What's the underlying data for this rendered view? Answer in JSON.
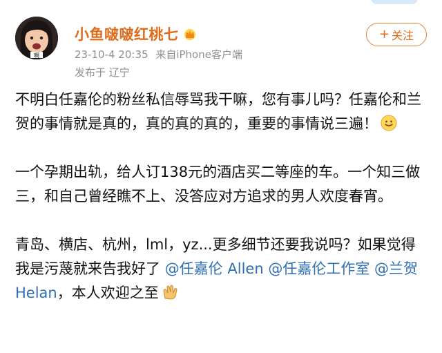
{
  "user": {
    "name": "小鱼啵啵红桃七",
    "meta_date": "23-10-4 20:35",
    "meta_source": "来自iPhone客户端",
    "location": "发布于 辽宁",
    "avatar_caption": "啊"
  },
  "follow_button": {
    "label": "关注",
    "icon": "plus-icon"
  },
  "post": {
    "p1": "不明白任嘉伦的粉丝私信辱骂我干嘛，您有事儿吗？任嘉伦和兰贺的事情就是真的，真的真的真的，重要的事情说三遍！",
    "p2": "一个孕期出轨，给人订138元的酒店买二等座的车。一个知三做三，和自己曾经瞧不上、没答应对方追求的男人欢度春宵。",
    "p3_text": "青岛、横店、杭州，lml，yz...更多细节还要我说吗？如果觉得我是污蔑就来告我好了 ",
    "mention1": "@任嘉伦 Allen",
    "mention2": "@任嘉伦工作室",
    "mention3": "@兰贺 Helan",
    "p3_tail": "，本人欢迎之至"
  },
  "colors": {
    "name": "#e06a17",
    "mention": "#2f6fb3",
    "meta": "#8f8f8f"
  },
  "icons": [
    "crown-icon",
    "smile-emoji",
    "clap-emoji"
  ]
}
